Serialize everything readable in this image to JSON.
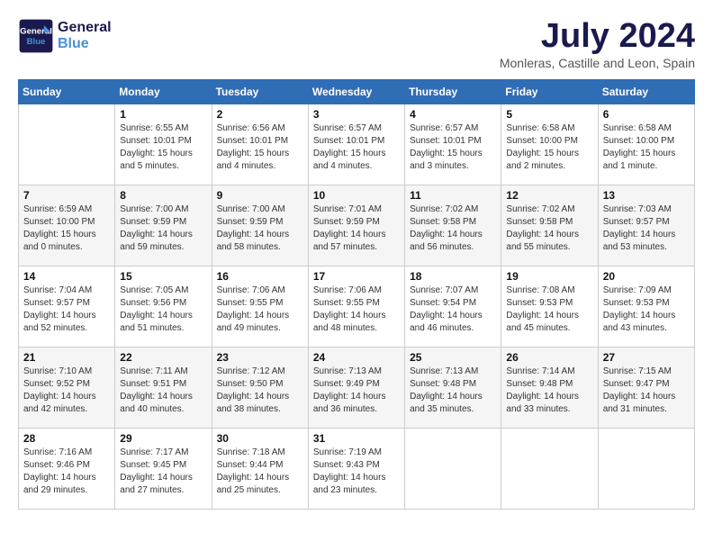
{
  "header": {
    "logo_line1": "General",
    "logo_line2": "Blue",
    "month_year": "July 2024",
    "location": "Monleras, Castille and Leon, Spain"
  },
  "weekdays": [
    "Sunday",
    "Monday",
    "Tuesday",
    "Wednesday",
    "Thursday",
    "Friday",
    "Saturday"
  ],
  "weeks": [
    [
      {
        "day": "",
        "info": ""
      },
      {
        "day": "1",
        "info": "Sunrise: 6:55 AM\nSunset: 10:01 PM\nDaylight: 15 hours\nand 5 minutes."
      },
      {
        "day": "2",
        "info": "Sunrise: 6:56 AM\nSunset: 10:01 PM\nDaylight: 15 hours\nand 4 minutes."
      },
      {
        "day": "3",
        "info": "Sunrise: 6:57 AM\nSunset: 10:01 PM\nDaylight: 15 hours\nand 4 minutes."
      },
      {
        "day": "4",
        "info": "Sunrise: 6:57 AM\nSunset: 10:01 PM\nDaylight: 15 hours\nand 3 minutes."
      },
      {
        "day": "5",
        "info": "Sunrise: 6:58 AM\nSunset: 10:00 PM\nDaylight: 15 hours\nand 2 minutes."
      },
      {
        "day": "6",
        "info": "Sunrise: 6:58 AM\nSunset: 10:00 PM\nDaylight: 15 hours\nand 1 minute."
      }
    ],
    [
      {
        "day": "7",
        "info": "Sunrise: 6:59 AM\nSunset: 10:00 PM\nDaylight: 15 hours\nand 0 minutes."
      },
      {
        "day": "8",
        "info": "Sunrise: 7:00 AM\nSunset: 9:59 PM\nDaylight: 14 hours\nand 59 minutes."
      },
      {
        "day": "9",
        "info": "Sunrise: 7:00 AM\nSunset: 9:59 PM\nDaylight: 14 hours\nand 58 minutes."
      },
      {
        "day": "10",
        "info": "Sunrise: 7:01 AM\nSunset: 9:59 PM\nDaylight: 14 hours\nand 57 minutes."
      },
      {
        "day": "11",
        "info": "Sunrise: 7:02 AM\nSunset: 9:58 PM\nDaylight: 14 hours\nand 56 minutes."
      },
      {
        "day": "12",
        "info": "Sunrise: 7:02 AM\nSunset: 9:58 PM\nDaylight: 14 hours\nand 55 minutes."
      },
      {
        "day": "13",
        "info": "Sunrise: 7:03 AM\nSunset: 9:57 PM\nDaylight: 14 hours\nand 53 minutes."
      }
    ],
    [
      {
        "day": "14",
        "info": "Sunrise: 7:04 AM\nSunset: 9:57 PM\nDaylight: 14 hours\nand 52 minutes."
      },
      {
        "day": "15",
        "info": "Sunrise: 7:05 AM\nSunset: 9:56 PM\nDaylight: 14 hours\nand 51 minutes."
      },
      {
        "day": "16",
        "info": "Sunrise: 7:06 AM\nSunset: 9:55 PM\nDaylight: 14 hours\nand 49 minutes."
      },
      {
        "day": "17",
        "info": "Sunrise: 7:06 AM\nSunset: 9:55 PM\nDaylight: 14 hours\nand 48 minutes."
      },
      {
        "day": "18",
        "info": "Sunrise: 7:07 AM\nSunset: 9:54 PM\nDaylight: 14 hours\nand 46 minutes."
      },
      {
        "day": "19",
        "info": "Sunrise: 7:08 AM\nSunset: 9:53 PM\nDaylight: 14 hours\nand 45 minutes."
      },
      {
        "day": "20",
        "info": "Sunrise: 7:09 AM\nSunset: 9:53 PM\nDaylight: 14 hours\nand 43 minutes."
      }
    ],
    [
      {
        "day": "21",
        "info": "Sunrise: 7:10 AM\nSunset: 9:52 PM\nDaylight: 14 hours\nand 42 minutes."
      },
      {
        "day": "22",
        "info": "Sunrise: 7:11 AM\nSunset: 9:51 PM\nDaylight: 14 hours\nand 40 minutes."
      },
      {
        "day": "23",
        "info": "Sunrise: 7:12 AM\nSunset: 9:50 PM\nDaylight: 14 hours\nand 38 minutes."
      },
      {
        "day": "24",
        "info": "Sunrise: 7:13 AM\nSunset: 9:49 PM\nDaylight: 14 hours\nand 36 minutes."
      },
      {
        "day": "25",
        "info": "Sunrise: 7:13 AM\nSunset: 9:48 PM\nDaylight: 14 hours\nand 35 minutes."
      },
      {
        "day": "26",
        "info": "Sunrise: 7:14 AM\nSunset: 9:48 PM\nDaylight: 14 hours\nand 33 minutes."
      },
      {
        "day": "27",
        "info": "Sunrise: 7:15 AM\nSunset: 9:47 PM\nDaylight: 14 hours\nand 31 minutes."
      }
    ],
    [
      {
        "day": "28",
        "info": "Sunrise: 7:16 AM\nSunset: 9:46 PM\nDaylight: 14 hours\nand 29 minutes."
      },
      {
        "day": "29",
        "info": "Sunrise: 7:17 AM\nSunset: 9:45 PM\nDaylight: 14 hours\nand 27 minutes."
      },
      {
        "day": "30",
        "info": "Sunrise: 7:18 AM\nSunset: 9:44 PM\nDaylight: 14 hours\nand 25 minutes."
      },
      {
        "day": "31",
        "info": "Sunrise: 7:19 AM\nSunset: 9:43 PM\nDaylight: 14 hours\nand 23 minutes."
      },
      {
        "day": "",
        "info": ""
      },
      {
        "day": "",
        "info": ""
      },
      {
        "day": "",
        "info": ""
      }
    ]
  ]
}
